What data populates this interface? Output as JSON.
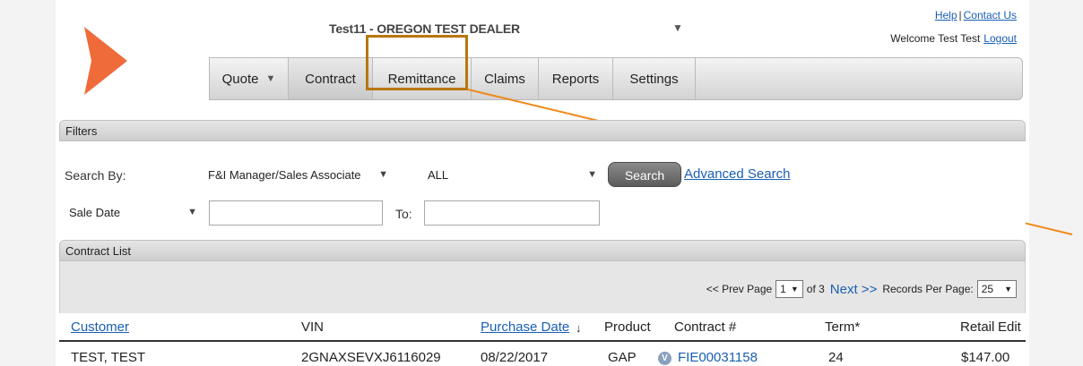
{
  "header": {
    "dealer_title": "Test11 - OREGON TEST DEALER",
    "help": "Help",
    "separator": "|",
    "contact": "Contact Us",
    "welcome": "Welcome Test Test",
    "logout": "Logout"
  },
  "nav": {
    "items": [
      {
        "label": "Quote",
        "has_caret": true
      },
      {
        "label": "Contract"
      },
      {
        "label": "Remittance"
      },
      {
        "label": "Claims"
      },
      {
        "label": "Reports"
      },
      {
        "label": "Settings"
      }
    ]
  },
  "filters": {
    "title": "Filters",
    "search_by_label": "Search By:",
    "search_by_value": "F&I Manager/Sales Associate",
    "scope_value": "ALL",
    "search_button": "Search",
    "advanced_search": "Advanced Search",
    "date_field_value": "Sale Date",
    "to_label": "To:"
  },
  "contract_list": {
    "title": "Contract List",
    "pager": {
      "prev": "<< Prev Page",
      "page": "1",
      "of": "of 3",
      "next": "Next >>",
      "records_label": "Records Per Page:",
      "records_value": "25"
    },
    "columns": {
      "customer": "Customer",
      "vin": "VIN",
      "purchase_date": "Purchase Date",
      "sort_arrow": "↓",
      "product": "Product",
      "contract": "Contract #",
      "term": "Term*",
      "retail": "Retail",
      "edit": "Edit"
    },
    "rows": [
      {
        "customer": "TEST, TEST",
        "vin": "2GNAXSEVXJ6116029",
        "purchase_date": "08/22/2017",
        "product": "GAP",
        "badge": "V",
        "contract": "FIE00031158",
        "term": "24",
        "retail": "$147.00"
      }
    ]
  },
  "colors": {
    "accent_orange": "#ef6b3a",
    "highlight_box": "#b7770e",
    "link_blue": "#1a5fb4"
  },
  "icons": {
    "logo": "chevron-logo-icon",
    "dropdown": "triangle-down-icon"
  }
}
